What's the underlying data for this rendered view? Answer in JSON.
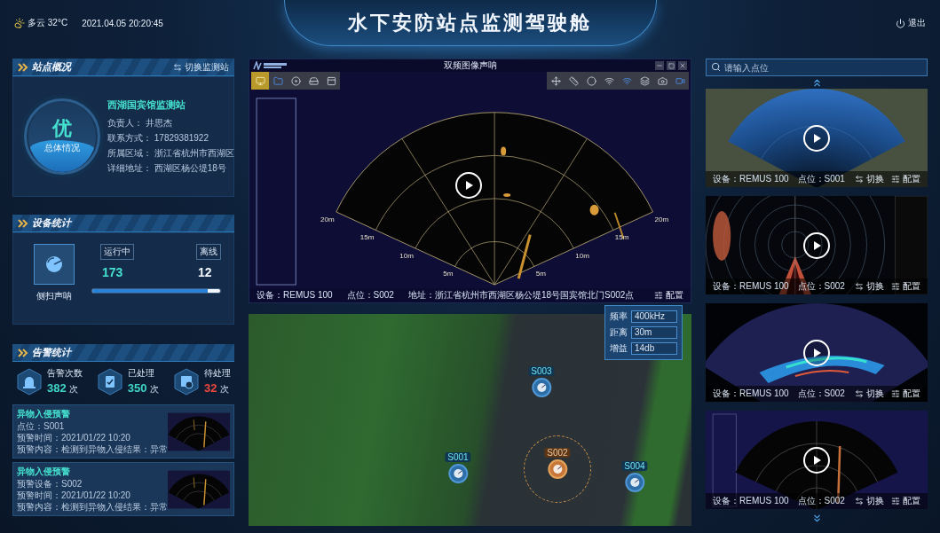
{
  "header": {
    "weather": "多云 32°C",
    "datetime": "2021.04.05 20:20:45",
    "title": "水下安防站点监测驾驶舱",
    "logout": "退出"
  },
  "station_overview": {
    "title": "站点概况",
    "switch": "切换监测站",
    "grade": "优",
    "grade_caption": "总体情况",
    "level": 0.45,
    "name": "西湖国宾馆监测站",
    "fields": [
      {
        "label": "负责人：",
        "value": "井思杰"
      },
      {
        "label": "联系方式：",
        "value": "17829381922"
      },
      {
        "label": "所属区域：",
        "value": "浙江省杭州市西湖区"
      },
      {
        "label": "详细地址：",
        "value": "西湖区杨公堤18号"
      }
    ]
  },
  "device_stats": {
    "title": "设备统计",
    "device": "侧扫声呐",
    "running_label": "运行中",
    "running": "173",
    "offline_label": "离线",
    "offline": "12",
    "level": 0.9
  },
  "alarm_stats": {
    "title": "告警统计",
    "stats": [
      {
        "kind": "total",
        "label": "告警次数",
        "value": "382",
        "unit": "次",
        "color": "#3fd6c8"
      },
      {
        "kind": "done",
        "label": "已处理",
        "value": "350",
        "unit": "次",
        "color": "#3fd6c8"
      },
      {
        "kind": "pending",
        "label": "待处理",
        "value": "32",
        "unit": "次",
        "color": "#f0483e"
      }
    ],
    "alerts": [
      {
        "title": "异物入侵预警",
        "lines": [
          "点位：S001",
          "预警时间：2021/01/22 10:20",
          "预警内容：检测到异物入侵结果：异常"
        ]
      },
      {
        "title": "异物入侵预警",
        "lines": [
          "预警设备：S002",
          "预警时间：2021/01/22 10:20",
          "预警内容：检测到异物入侵结果：异常"
        ]
      }
    ]
  },
  "sonar_window": {
    "title": "双频图像声呐",
    "left_tools": [
      {
        "selected": true
      },
      {
        "selected": false
      },
      {
        "selected": false
      },
      {
        "selected": false
      },
      {
        "selected": false
      }
    ],
    "range_labels_left": [
      "20m",
      "15m",
      "10m",
      "5m"
    ],
    "range_labels_right": [
      "20m",
      "15m",
      "10m",
      "5m"
    ],
    "device": "设备：REMUS 100",
    "point": "点位：S002",
    "address": "地址：浙江省杭州市西湖区杨公堤18号国宾馆北门S002点",
    "config": "配置"
  },
  "settings_popup": [
    {
      "label": "频率",
      "value": "400kHz"
    },
    {
      "label": "距离",
      "value": "30m"
    },
    {
      "label": "增益",
      "value": "14db"
    }
  ],
  "map": {
    "markers": [
      {
        "label": "S003",
        "selected": false
      },
      {
        "label": "S002",
        "selected": true
      },
      {
        "label": "S001",
        "selected": false
      },
      {
        "label": "S004",
        "selected": false
      }
    ]
  },
  "feeds_panel": {
    "search_placeholder": "请输入点位",
    "feeds": [
      {
        "kind": "fan-blue",
        "device": "设备：REMUS 100",
        "point": "点位：S001",
        "switch": "切换",
        "config": "配置"
      },
      {
        "kind": "circular",
        "device": "设备：REMUS 100",
        "point": "点位：S002",
        "switch": "切换",
        "config": "配置"
      },
      {
        "kind": "fan-heat",
        "device": "设备：REMUS 100",
        "point": "点位：S002",
        "switch": "切换",
        "config": "配置"
      },
      {
        "kind": "fan-dark",
        "device": "设备：REMUS 100",
        "point": "点位：S002",
        "switch": "切换",
        "config": "配置"
      }
    ]
  }
}
